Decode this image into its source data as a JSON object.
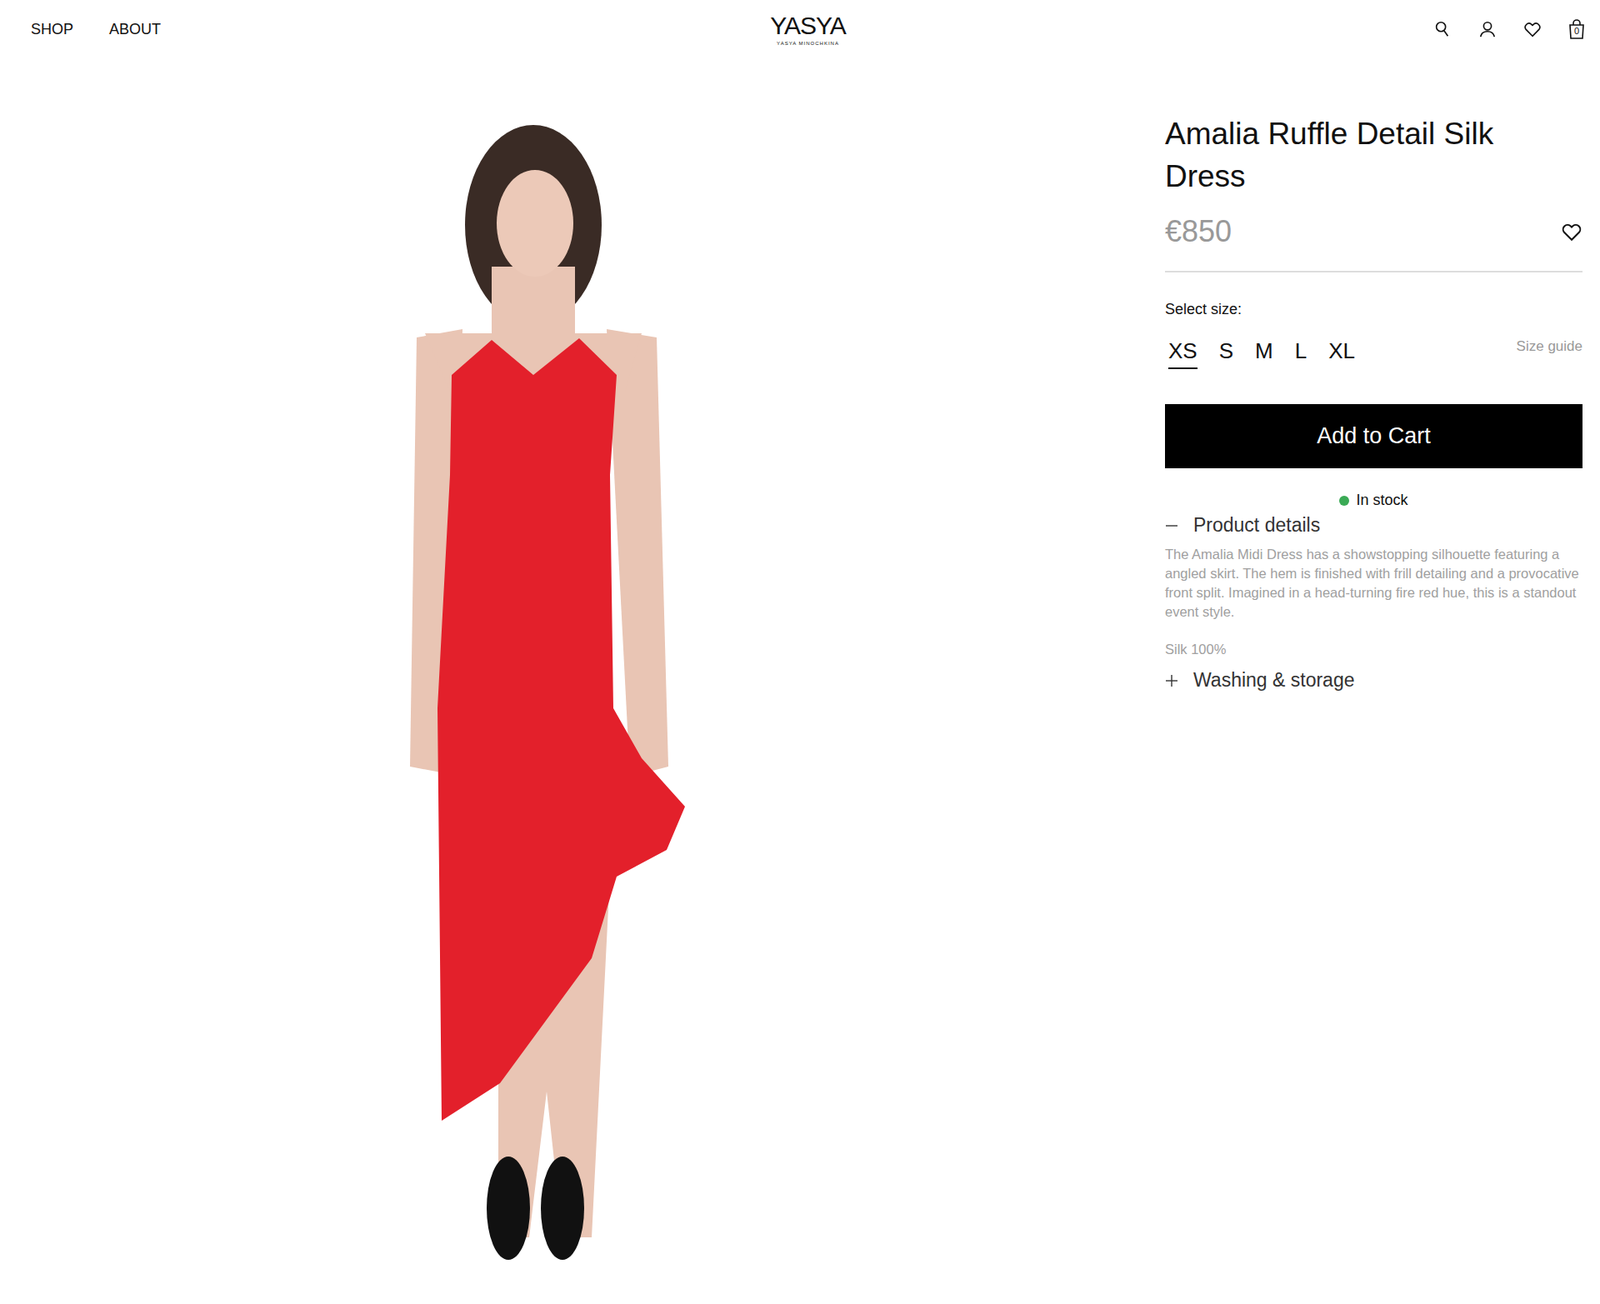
{
  "nav": {
    "links": [
      "SHOP",
      "ABOUT"
    ],
    "logo": {
      "mark": "YASYA",
      "subtitle": "YASYA MINOCHKINA"
    },
    "cart_count": "0"
  },
  "product": {
    "title": "Amalia Ruffle Detail Silk Dress",
    "price": "€850",
    "size_label": "Select size:",
    "sizes": [
      {
        "label": "XS",
        "selected": true
      },
      {
        "label": "S",
        "selected": false
      },
      {
        "label": "M",
        "selected": false
      },
      {
        "label": "L",
        "selected": false
      },
      {
        "label": "XL",
        "selected": false
      }
    ],
    "size_guide": "Size guide",
    "add_to_cart": "Add to Cart",
    "stock": "In stock",
    "sections": [
      {
        "label": "Product details",
        "expanded": true,
        "text": "The Amalia Midi Dress has a showstopping silhouette featuring a angled skirt. The hem is finished with frill detailing and a provocative front split. Imagined in a head-turning fire red hue, this is a standout event style.",
        "material": "Silk 100%"
      },
      {
        "label": "Washing & storage",
        "expanded": false
      }
    ]
  }
}
